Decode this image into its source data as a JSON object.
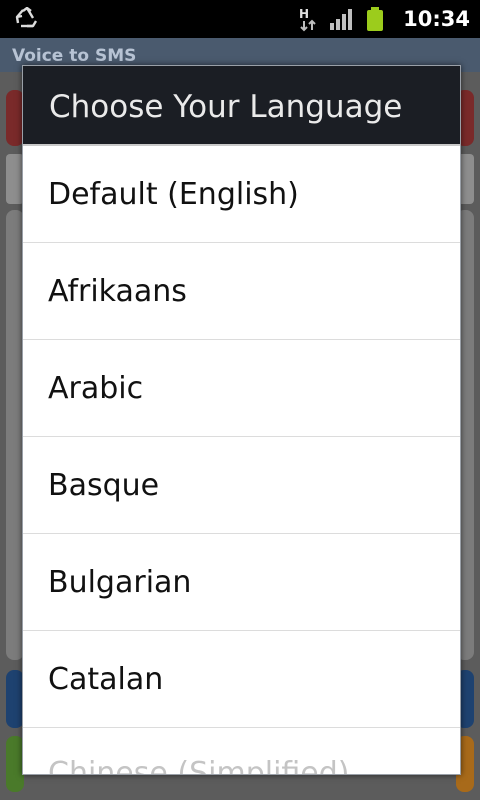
{
  "status_bar": {
    "time": "10:34",
    "icons": [
      "recycle-icon",
      "h-data-icon",
      "signal-icon",
      "battery-icon"
    ],
    "battery_color": "#9ccc1c"
  },
  "app": {
    "title": "Voice to SMS"
  },
  "dialog": {
    "title": "Choose Your Language",
    "items": [
      "Default (English)",
      "Afrikaans",
      "Arabic",
      "Basque",
      "Bulgarian",
      "Catalan",
      "Chinese (Simplified)"
    ]
  }
}
